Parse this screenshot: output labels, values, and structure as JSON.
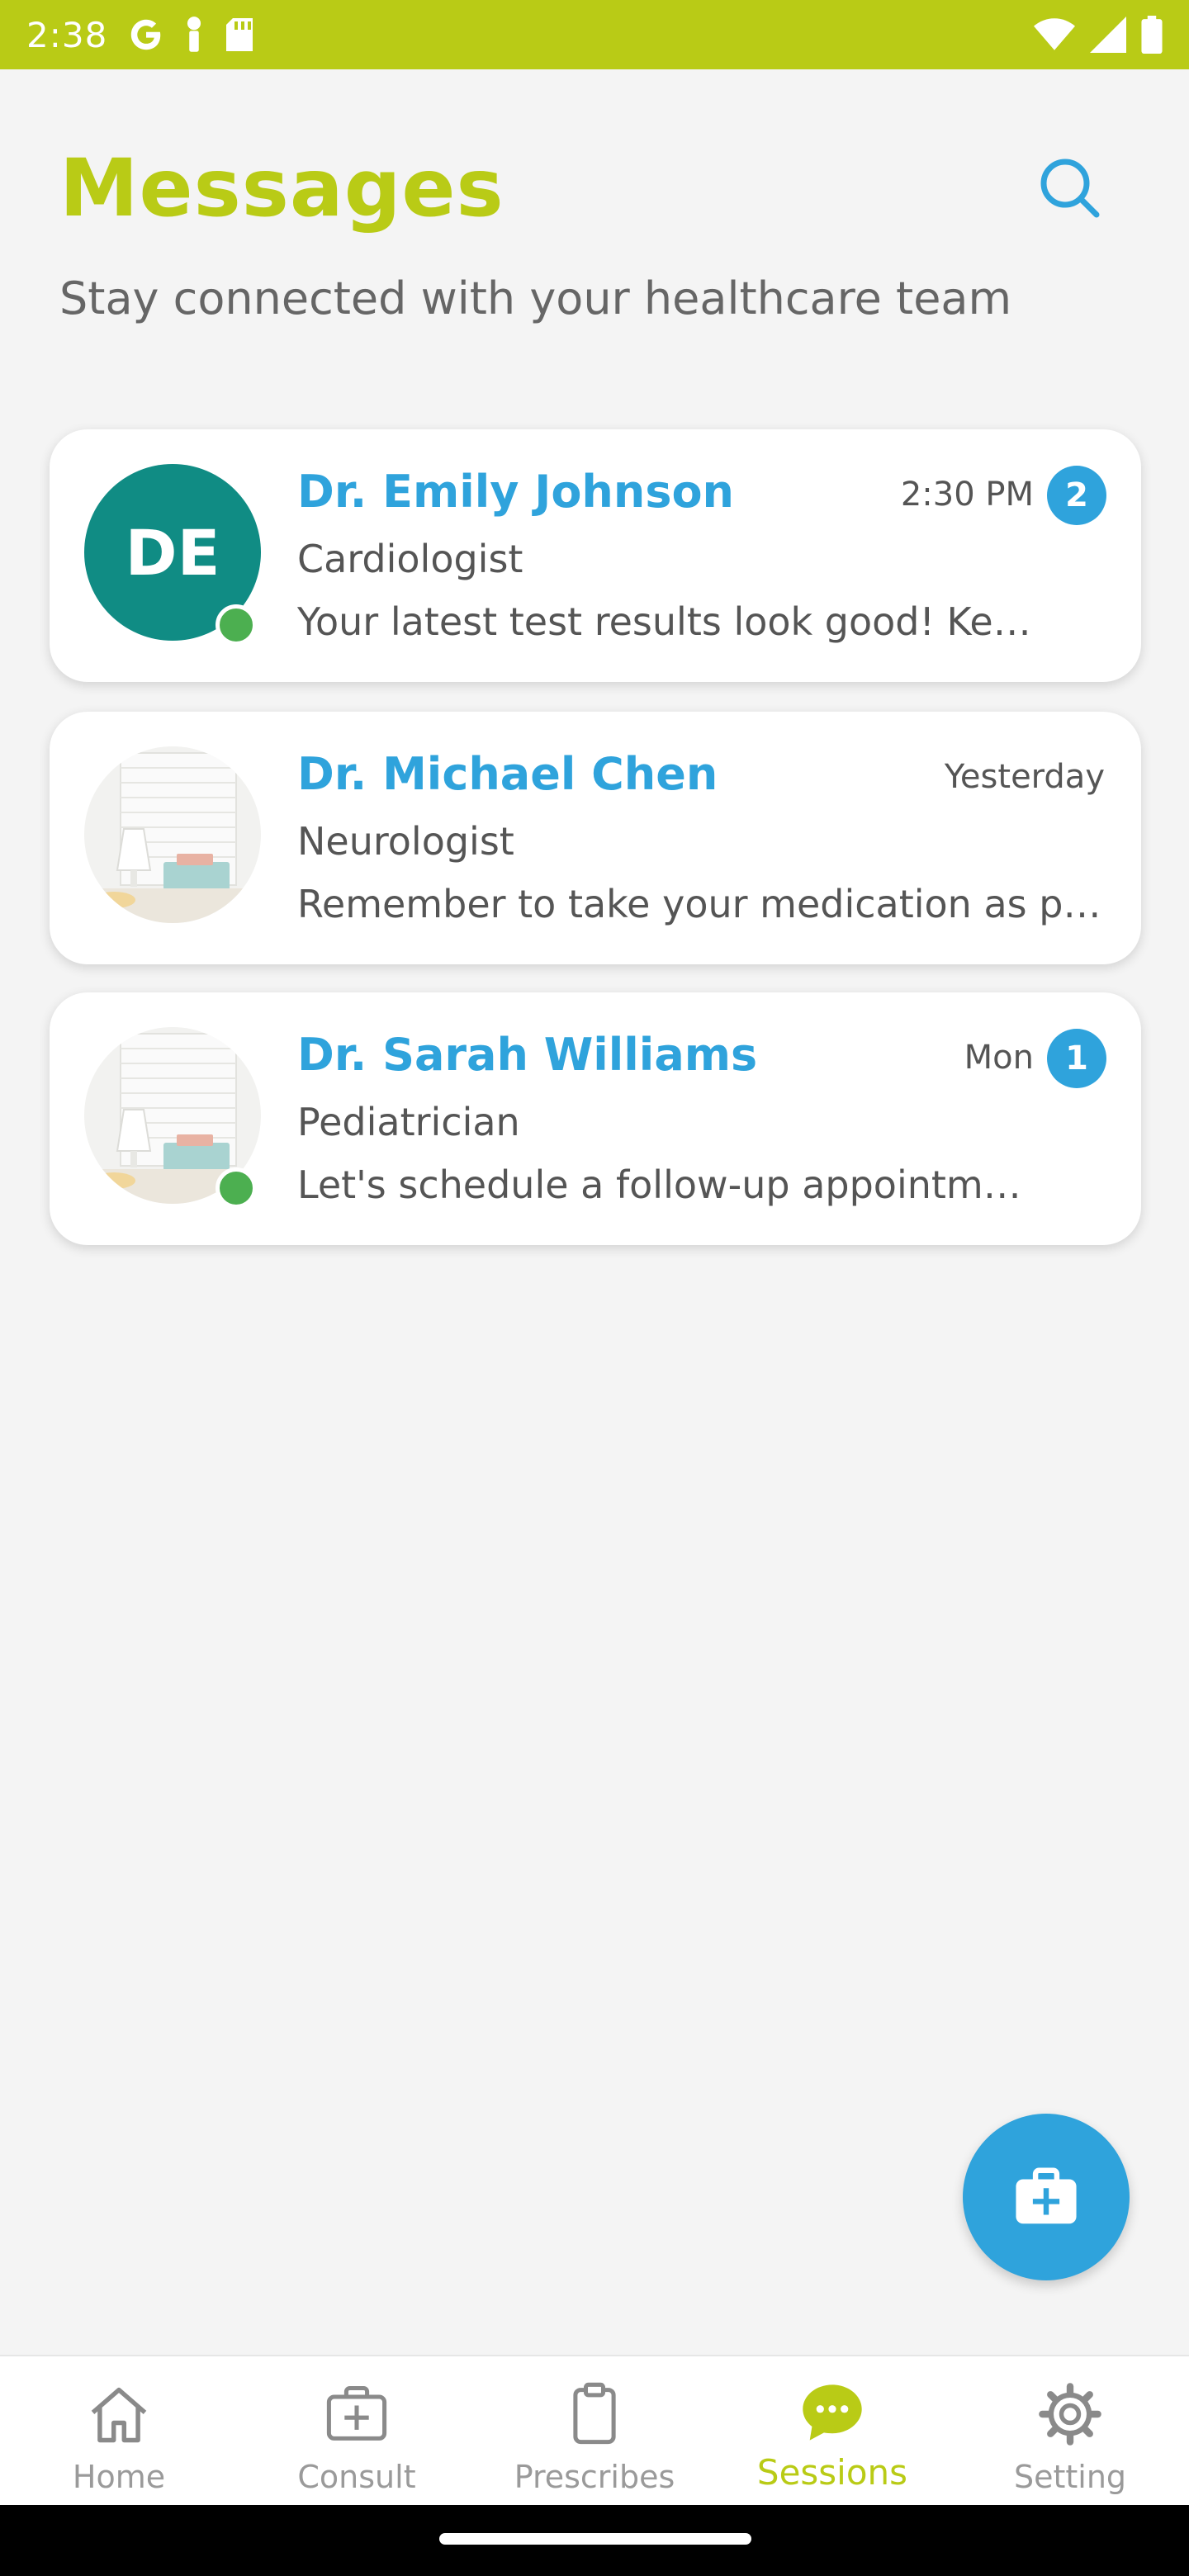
{
  "status_bar": {
    "time": "2:38",
    "icons": [
      "google-icon",
      "notification-icon",
      "sd-card-icon",
      "wifi-icon",
      "signal-icon",
      "battery-icon"
    ]
  },
  "header": {
    "title": "Messages",
    "subtitle": "Stay connected with your healthcare team",
    "search_icon": "search-icon"
  },
  "conversations": [
    {
      "initials": "DE",
      "name": "Dr. Emily Johnson",
      "specialty": "Cardiologist",
      "preview": "Your latest test results look good! Keep up the healthy habits.",
      "time": "2:30 PM",
      "unread": "2",
      "online": true,
      "avatar_type": "initials"
    },
    {
      "initials": "",
      "name": "Dr. Michael Chen",
      "specialty": "Neurologist",
      "preview": "Remember to take your medication as prescribed.",
      "time": "Yesterday",
      "unread": "",
      "online": false,
      "avatar_type": "photo"
    },
    {
      "initials": "",
      "name": "Dr. Sarah Williams",
      "specialty": "Pediatrician",
      "preview": "Let's schedule a follow-up appointment next week.",
      "time": "Mon",
      "unread": "1",
      "online": true,
      "avatar_type": "photo"
    }
  ],
  "fab": {
    "icon": "medical-kit-icon"
  },
  "bottom_nav": {
    "items": [
      {
        "label": "Home",
        "icon": "home-icon",
        "active": false
      },
      {
        "label": "Consult",
        "icon": "consult-icon",
        "active": false
      },
      {
        "label": "Prescribes",
        "icon": "clipboard-icon",
        "active": false
      },
      {
        "label": "Sessions",
        "icon": "chat-bubble-icon",
        "active": true
      },
      {
        "label": "Setting",
        "icon": "gear-icon",
        "active": false
      }
    ]
  },
  "colors": {
    "brand_green": "#b9cb16",
    "accent_blue": "#2fa3dc",
    "teal_avatar": "#108c84",
    "online_green": "#4caf50",
    "background": "#f4f4f4"
  }
}
